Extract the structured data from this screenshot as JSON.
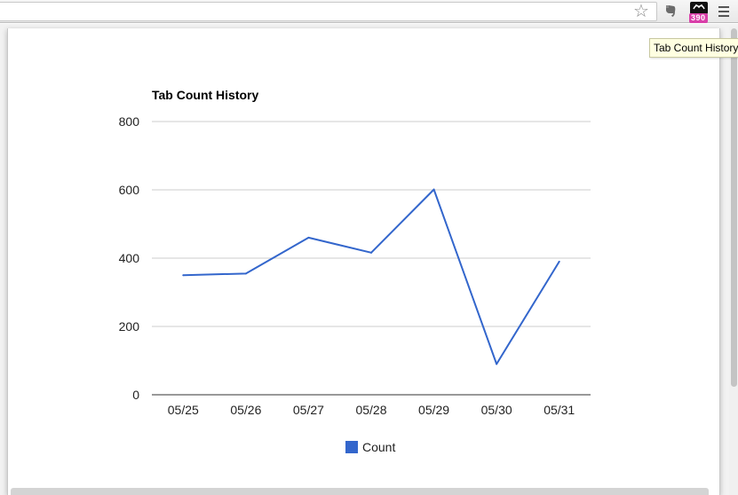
{
  "browser": {
    "tooltip": "Tab Count History",
    "extension_badge": "390",
    "icons": [
      "bookmark-star-icon",
      "evernote-icon",
      "tab-count-extension-icon",
      "menu-icon"
    ]
  },
  "colors": {
    "series": "#3366cc",
    "grid": "#cccccc",
    "badge": "#d93fa9"
  },
  "chart_data": {
    "type": "line",
    "title": "Tab Count History",
    "categories": [
      "05/25",
      "05/26",
      "05/27",
      "05/28",
      "05/29",
      "05/30",
      "05/31"
    ],
    "series": [
      {
        "name": "Count",
        "values": [
          350,
          355,
          460,
          416,
          601,
          90,
          390
        ]
      }
    ],
    "ylim": [
      0,
      800
    ],
    "yticks": [
      "0",
      "200",
      "400",
      "600",
      "800"
    ],
    "grid": true,
    "legend": "bottom"
  }
}
